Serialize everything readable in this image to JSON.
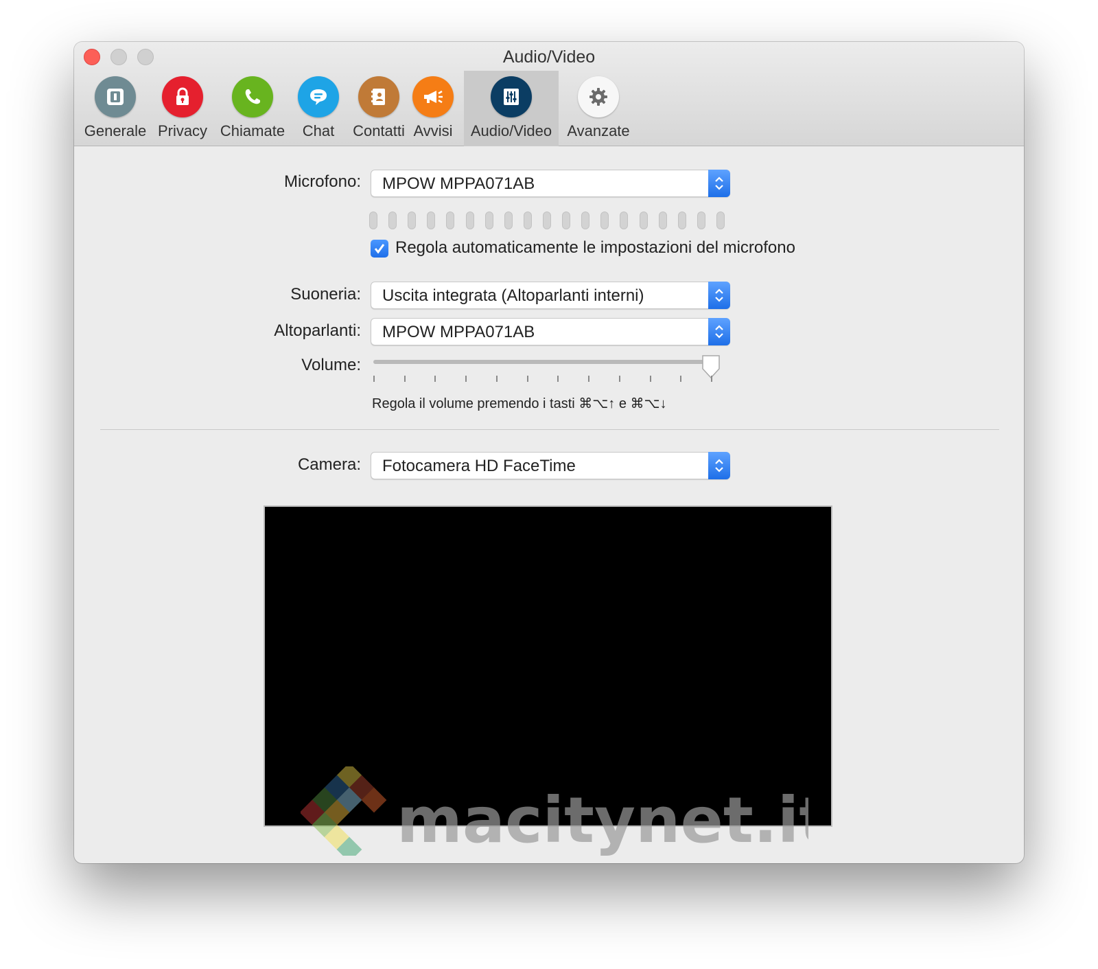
{
  "window": {
    "title": "Audio/Video"
  },
  "toolbar": {
    "tabs": [
      {
        "label": "Generale",
        "icon": "generale-icon",
        "color": "#6f8b93",
        "active": false
      },
      {
        "label": "Privacy",
        "icon": "lock-icon",
        "color": "#e5202e",
        "active": false
      },
      {
        "label": "Chiamate",
        "icon": "phone-icon",
        "color": "#68b41f",
        "active": false
      },
      {
        "label": "Chat",
        "icon": "chat-bubble-icon",
        "color": "#1ea4e6",
        "active": false
      },
      {
        "label": "Contatti",
        "icon": "contacts-book-icon",
        "color": "#c07a37",
        "active": false
      },
      {
        "label": "Avvisi",
        "icon": "megaphone-icon",
        "color": "#f57d15",
        "active": false
      },
      {
        "label": "Audio/Video",
        "icon": "equalizer-icon",
        "color": "#0b3d63",
        "active": true
      },
      {
        "label": "Avanzate",
        "icon": "gear-icon",
        "color": "#f7f7f7",
        "active": false
      }
    ]
  },
  "audio": {
    "microphone_label": "Microfono:",
    "microphone_value": "MPOW MPPA071AB",
    "mic_level_segments": 19,
    "mic_level_active": 0,
    "auto_adjust_label": "Regola automaticamente le impostazioni del microfono",
    "auto_adjust_checked": true,
    "ringtone_label": "Suoneria:",
    "ringtone_value": "Uscita integrata (Altoparlanti interni)",
    "speakers_label": "Altoparlanti:",
    "speakers_value": "MPOW MPPA071AB",
    "volume_label": "Volume:",
    "volume_level": 1.0,
    "volume_hint": "Regola il volume premendo i tasti ⌘⌥↑ e ⌘⌥↓"
  },
  "video": {
    "camera_label": "Camera:",
    "camera_value": "Fotocamera HD FaceTime"
  },
  "watermark": {
    "text": "macitynet.it"
  },
  "colors": {
    "accent": "#2a7cf0",
    "close": "#fc5f57"
  }
}
